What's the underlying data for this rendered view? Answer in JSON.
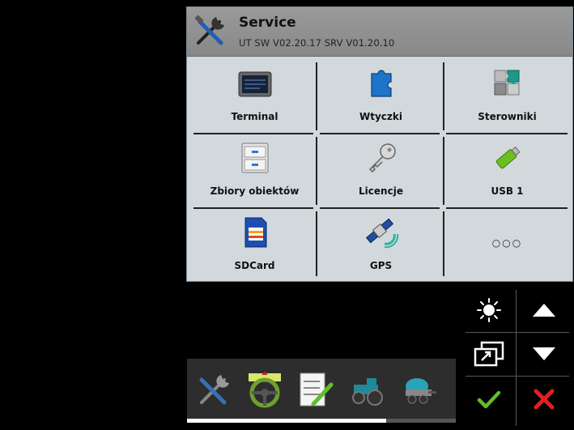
{
  "header": {
    "title": "Service",
    "subtitle": "UT SW V02.20.17 SRV V01.20.10",
    "icon": "tools-icon"
  },
  "grid": {
    "items": [
      {
        "label": "Terminal",
        "icon": "terminal-icon"
      },
      {
        "label": "Wtyczki",
        "icon": "puzzle-icon"
      },
      {
        "label": "Sterowniki",
        "icon": "puzzle-pieces-icon"
      },
      {
        "label": "Zbiory obiektów",
        "icon": "file-cabinet-icon"
      },
      {
        "label": "Licencje",
        "icon": "key-icon"
      },
      {
        "label": "USB 1",
        "icon": "usb-stick-icon"
      },
      {
        "label": "SDCard",
        "icon": "sd-card-icon"
      },
      {
        "label": "GPS",
        "icon": "satellite-icon"
      },
      {
        "label": "",
        "icon": "more-dots-icon"
      }
    ],
    "more_label": "○○○"
  },
  "bottombar": {
    "apps": [
      "tools-icon",
      "steering-wheel-icon",
      "checklist-icon",
      "tractor-icon",
      "sprayer-icon"
    ],
    "progress": 0.74
  },
  "side_controls": [
    "brightness-icon",
    "arrow-up-icon",
    "window-switch-icon",
    "arrow-down-icon",
    "confirm-check-icon",
    "cancel-x-icon"
  ],
  "colors": {
    "panel_bg": "#d2d9dc",
    "header_bg": "#909090",
    "confirm": "#5fbf2a",
    "cancel": "#e02020"
  }
}
